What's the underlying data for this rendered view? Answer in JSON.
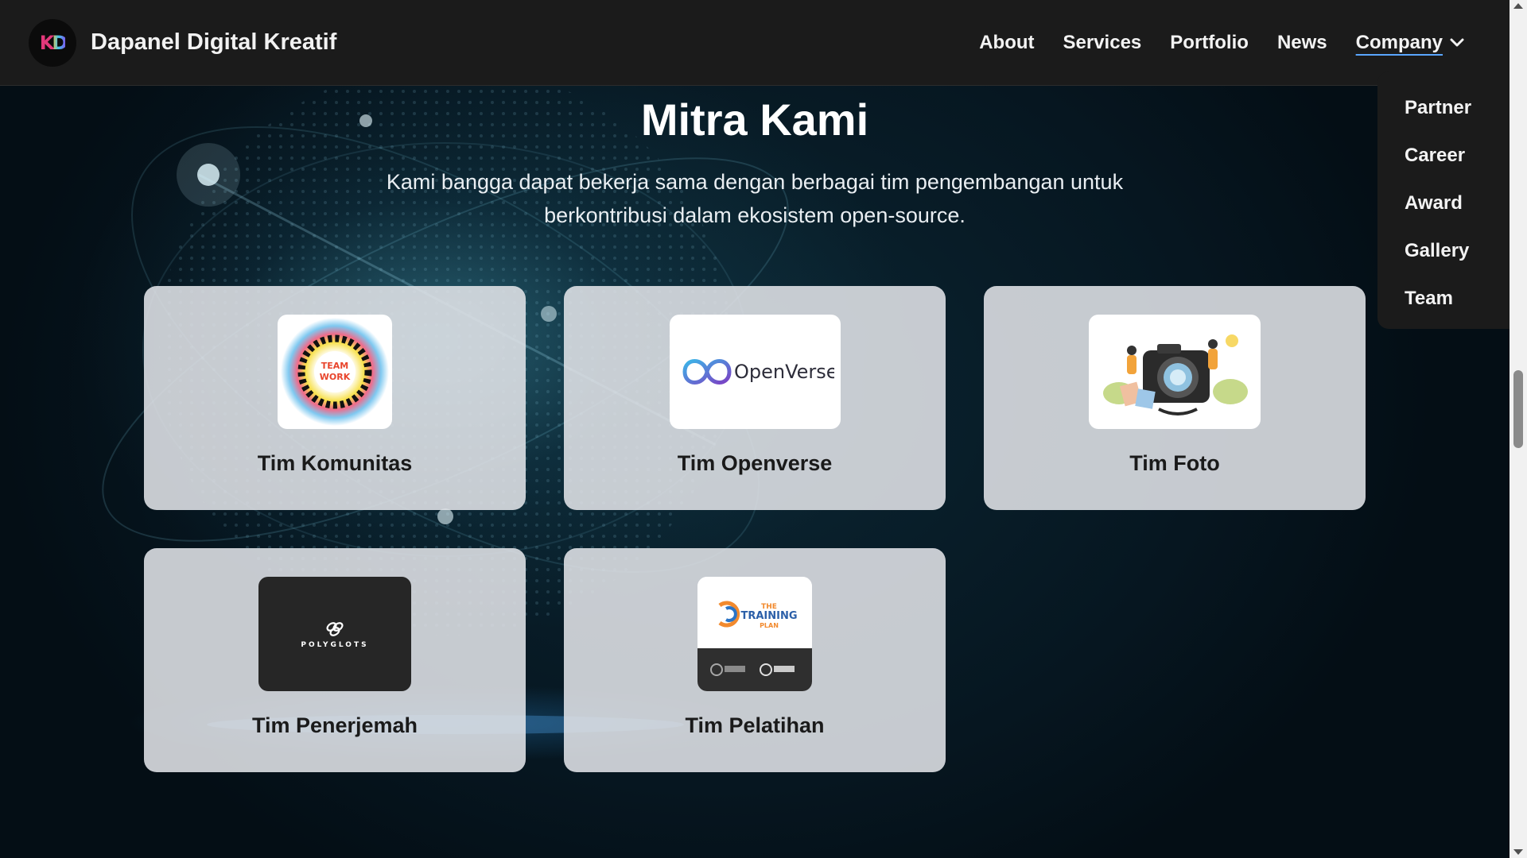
{
  "brand": {
    "name": "Dapanel Digital Kreatif",
    "logo_left": "K",
    "logo_right": "D"
  },
  "nav": {
    "about": "About",
    "services": "Services",
    "portfolio": "Portfolio",
    "news": "News",
    "company": "Company"
  },
  "dropdown": [
    "Partner",
    "Career",
    "Award",
    "Gallery",
    "Team"
  ],
  "section": {
    "title": "Mitra Kami",
    "subtitle": "Kami bangga dapat bekerja sama dengan berbagai tim pengembangan untuk berkontribusi dalam ekosistem open-source."
  },
  "partners": [
    {
      "name": "Tim Komunitas",
      "logo_text": [
        "TEAM",
        "WORK"
      ]
    },
    {
      "name": "Tim Openverse",
      "logo_text": "OpenVerse"
    },
    {
      "name": "Tim Foto"
    },
    {
      "name": "Tim Penerjemah",
      "logo_text": "POLYGLOTS"
    },
    {
      "name": "Tim Pelatihan",
      "logo_text": [
        "THE",
        "TRAINING",
        "PLAN"
      ]
    }
  ],
  "colors": {
    "navbar": "#1b1b1b",
    "card": "#e1e4e8",
    "accent_underline": "#5aa6ff"
  }
}
